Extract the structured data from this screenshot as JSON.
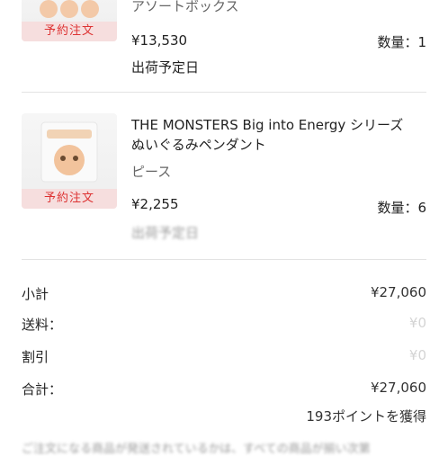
{
  "items": [
    {
      "badge": "予約注文",
      "subtitle": "アソートボックス",
      "price": "¥13,530",
      "quantity": "数量：1",
      "shipping": "出荷予定日"
    },
    {
      "badge": "予約注文",
      "title_line1": "THE MONSTERS Big into Energy シリーズ",
      "title_line2": "ぬいぐるみペンダント",
      "variant": "ピース",
      "price": "¥2,255",
      "quantity": "数量：6",
      "shipping": "出荷予定日"
    }
  ],
  "summary": {
    "subtotal_label": "小計",
    "subtotal_value": "¥27,060",
    "shipping_label": "送料：",
    "shipping_value": "¥0",
    "discount_label": "割引",
    "discount_value": "¥0",
    "total_label": "合計：",
    "total_value": "¥27,060",
    "points_text": "193ポイントを獲得"
  },
  "footer_text": "ご注文になる商品が発送されているかは、すべての商品が揃い次第"
}
